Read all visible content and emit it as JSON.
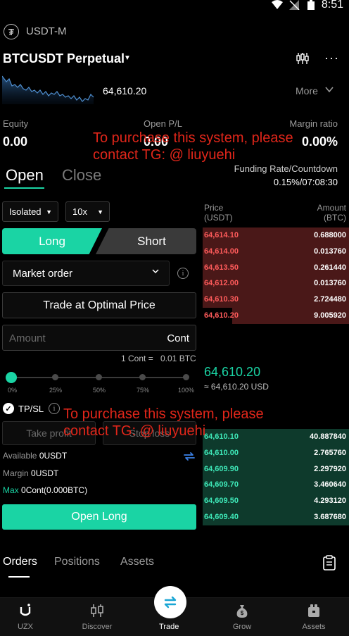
{
  "status_bar": {
    "time": "8:51"
  },
  "header": {
    "contract_label": "USDT-M",
    "symbol": "BTCUSDT Perpetual",
    "last_price": "64,610.20",
    "more_label": "More"
  },
  "stats": {
    "equity_label": "Equity",
    "equity_value": "0.00",
    "pnl_label": "Open P/L",
    "pnl_value": "0.00",
    "margin_ratio_label": "Margin ratio",
    "margin_ratio_value": "0.00%"
  },
  "watermark": {
    "line1": "To purchase this system, please",
    "line2": "contact TG: @ liuyuehi"
  },
  "tabs": {
    "open": "Open",
    "close": "Close"
  },
  "funding": {
    "label": "Funding Rate/Countdown",
    "value": "0.15%/07:08:30"
  },
  "form": {
    "margin_mode": "Isolated",
    "leverage": "10x",
    "long_label": "Long",
    "short_label": "Short",
    "order_type": "Market order",
    "optimal_price": "Trade at Optimal Price",
    "amount_placeholder": "Amount",
    "amount_unit": "Cont",
    "cont_note": "1 Cont =",
    "cont_value": "0.01 BTC",
    "slider_percent": 0,
    "slider_labels": [
      "0%",
      "25%",
      "50%",
      "75%",
      "100%"
    ],
    "tpsl_label": "TP/SL",
    "take_profit_placeholder": "Take profit",
    "stop_loss_placeholder": "Stop loss",
    "available_label": "Available",
    "available_value": "0USDT",
    "margin_label": "Margin",
    "margin_value": "0USDT",
    "max_label": "Max",
    "max_value": "0Cont(0.000BTC)",
    "submit_label": "Open Long"
  },
  "order_book": {
    "price_header": "Price",
    "price_unit": "(USDT)",
    "amount_header": "Amount",
    "amount_unit": "(BTC)",
    "asks": [
      {
        "price": "64,614.10",
        "amount": "0.688000",
        "depth": 1.0
      },
      {
        "price": "64,614.00",
        "amount": "0.013760",
        "depth": 1.0
      },
      {
        "price": "64,613.50",
        "amount": "0.261440",
        "depth": 1.0
      },
      {
        "price": "64,612.00",
        "amount": "0.013760",
        "depth": 1.0
      },
      {
        "price": "64,610.30",
        "amount": "2.724480",
        "depth": 1.0
      },
      {
        "price": "64,610.20",
        "amount": "9.005920",
        "depth": 0.8
      }
    ],
    "mid_price": "64,610.20",
    "mid_usd": "≈ 64,610.20 USD",
    "bids": [
      {
        "price": "64,610.10",
        "amount": "40.887840",
        "depth": 1.0
      },
      {
        "price": "64,610.00",
        "amount": "2.765760",
        "depth": 1.0
      },
      {
        "price": "64,609.90",
        "amount": "2.297920",
        "depth": 1.0
      },
      {
        "price": "64,609.70",
        "amount": "3.460640",
        "depth": 1.0
      },
      {
        "price": "64,609.50",
        "amount": "4.293120",
        "depth": 1.0
      },
      {
        "price": "64,609.40",
        "amount": "3.687680",
        "depth": 1.0
      }
    ]
  },
  "bottom_tabs": {
    "orders": "Orders",
    "positions": "Positions",
    "assets": "Assets"
  },
  "nav": {
    "uzx": "UZX",
    "discover": "Discover",
    "trade": "Trade",
    "grow": "Grow",
    "assets": "Assets"
  },
  "colors": {
    "accent": "#1ad4a4",
    "ask": "#ff5b5b",
    "watermark": "#e0261a"
  }
}
